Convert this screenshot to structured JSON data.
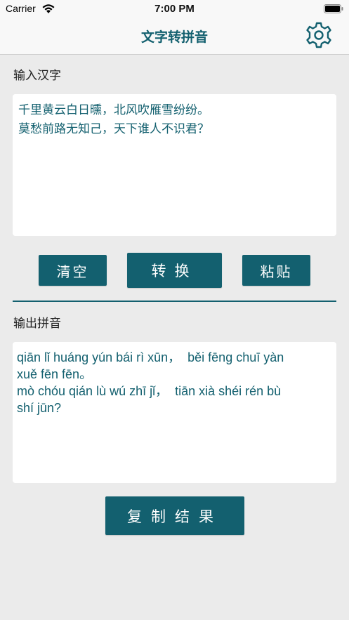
{
  "status_bar": {
    "carrier": "Carrier",
    "time": "7:00 PM",
    "icons": [
      "wifi-icon",
      "battery-icon"
    ]
  },
  "nav": {
    "title": "文字转拼音",
    "settings_icon": "gear-icon"
  },
  "input_section": {
    "label": "输入汉字",
    "lines": [
      "千里黄云白日曛，北风吹雁雪纷纷。",
      "莫愁前路无知己，天下谁人不识君？"
    ]
  },
  "buttons": {
    "clear": "清空",
    "convert": "转换",
    "paste": "粘贴",
    "copy": "复制结果"
  },
  "output_section": {
    "label": "输出拼音",
    "lines": [
      "qiān lǐ huáng yún bái rì xūn，  běi fēng chuī yàn",
      "xuě fēn fēn。",
      "mò chóu qián lù wú zhī jǐ，  tiān xià shéi rén bù",
      "shí jūn?"
    ]
  },
  "colors": {
    "accent": "#13606f",
    "background": "#ebebeb",
    "panel": "#ffffff"
  }
}
